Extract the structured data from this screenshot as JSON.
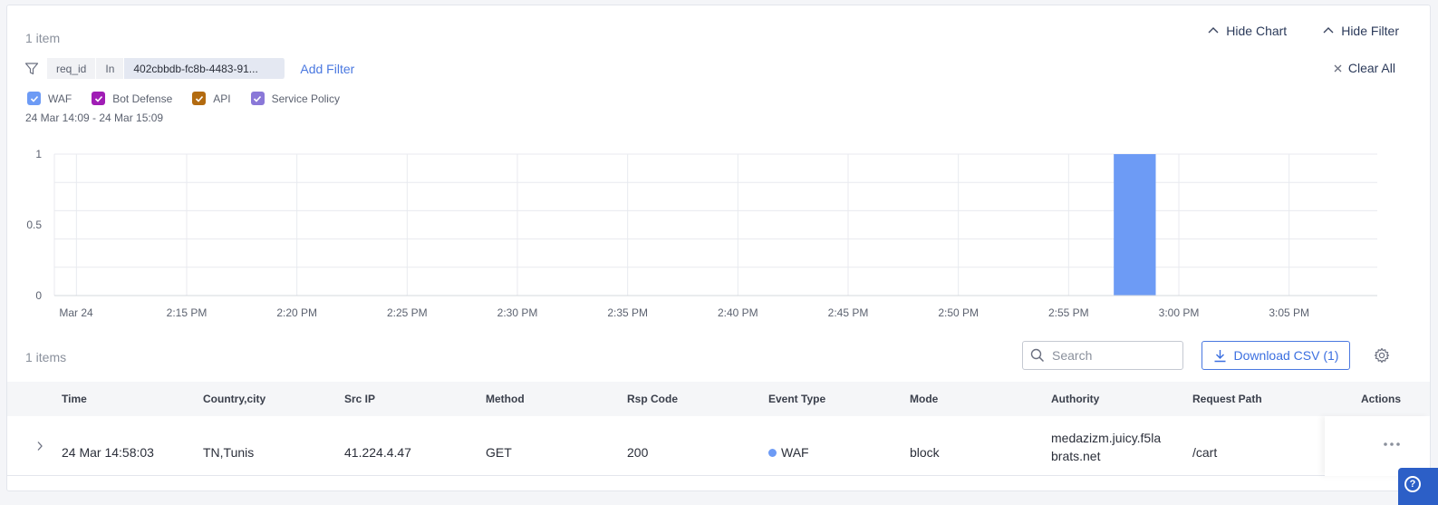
{
  "header": {
    "item_count": "1 item",
    "hide_chart_label": "Hide Chart",
    "hide_filter_label": "Hide Filter"
  },
  "filter": {
    "field": "req_id",
    "operator": "In",
    "value": "402cbbdb-fc8b-4483-91...",
    "add_filter_label": "Add Filter",
    "clear_all_label": "Clear All"
  },
  "legend": [
    {
      "label": "WAF",
      "color": "#6d9bf5"
    },
    {
      "label": "Bot Defense",
      "color": "#a01db5"
    },
    {
      "label": "API",
      "color": "#b36b10"
    },
    {
      "label": "Service Policy",
      "color": "#8a78d8"
    }
  ],
  "date_range": "24 Mar 14:09 - 24 Mar 15:09",
  "chart_data": {
    "type": "bar",
    "x": [
      "Mar 24",
      "2:15 PM",
      "2:20 PM",
      "2:25 PM",
      "2:30 PM",
      "2:35 PM",
      "2:40 PM",
      "2:45 PM",
      "2:50 PM",
      "2:55 PM",
      "3:00 PM",
      "3:05 PM"
    ],
    "y_ticks": [
      "1",
      "0.5",
      "0"
    ],
    "ylim": [
      0,
      1
    ],
    "series": [
      {
        "name": "WAF",
        "color": "#6d9bf5",
        "points": [
          {
            "x": "14:58",
            "y": 1
          }
        ]
      }
    ],
    "grid": true
  },
  "table": {
    "count_label": "1 items",
    "search_placeholder": "Search",
    "download_label": "Download CSV (1)",
    "columns": [
      "Time",
      "Country,city",
      "Src IP",
      "Method",
      "Rsp Code",
      "Event Type",
      "Mode",
      "Authority",
      "Request Path",
      "Actions"
    ],
    "rows": [
      {
        "time": "24 Mar 14:58:03",
        "country_city": "TN,Tunis",
        "src_ip": "41.224.4.47",
        "method": "GET",
        "rsp_code": "200",
        "event_type": "WAF",
        "mode": "block",
        "authority_line1": "medazizm.juicy.f5la",
        "authority_line2": "brats.net",
        "request_path": "/cart"
      }
    ]
  },
  "help": {
    "label": "?"
  }
}
